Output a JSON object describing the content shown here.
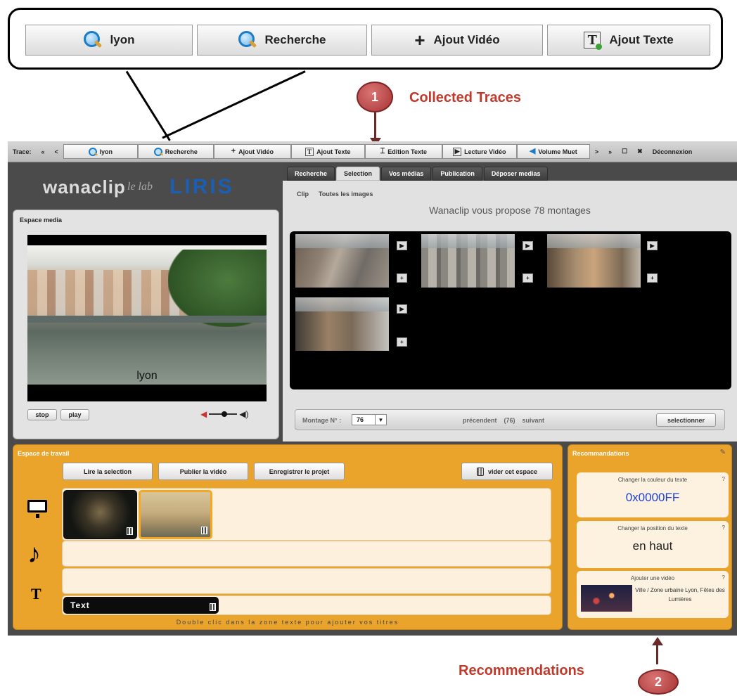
{
  "callout": {
    "buttons": [
      {
        "label": "lyon",
        "icon": "search-icon"
      },
      {
        "label": "Recherche",
        "icon": "search-icon"
      },
      {
        "label": "Ajout Vidéo",
        "icon": "plus-icon"
      },
      {
        "label": "Ajout Texte",
        "icon": "text-icon"
      }
    ]
  },
  "annotations": {
    "marker1": "1",
    "label1": "Collected Traces",
    "marker2": "2",
    "label2": "Recommendations"
  },
  "toolbar": {
    "trace_label": "Trace:",
    "first": "«",
    "prev": "<",
    "buttons": [
      "lyon",
      "Recherche",
      "Ajout Vidéo",
      "Ajout Texte",
      "Edition Texte",
      "Lecture Vidéo",
      "Volume Muet"
    ],
    "next": ">",
    "last": "»",
    "close": "✖",
    "logout": "Déconnexion"
  },
  "logo": {
    "wana": "wanaclip",
    "lelab": "le lab",
    "liris": "LIRIS"
  },
  "media": {
    "title": "Espace media",
    "caption": "lyon",
    "stop": "stop",
    "play": "play"
  },
  "tabs": [
    "Recherche",
    "Selection",
    "Vos médias",
    "Publication",
    "Déposer medias"
  ],
  "selection": {
    "links": [
      "Clip",
      "Toutes les images"
    ],
    "propose": "Wanaclip vous propose 78 montages",
    "play_glyph": "▶",
    "add_glyph": "+",
    "montage_label": "Montage N° :",
    "montage_value": "76",
    "dropdown_glyph": "▼",
    "prev": "précendent",
    "count": "(76)",
    "next": "suivant",
    "select_button": "selectionner"
  },
  "workspace": {
    "title": "Espace de travail",
    "buttons": [
      "Lire la selection",
      "Publier la vidéo",
      "Enregistrer le projet"
    ],
    "clear": "vider cet espace",
    "text_clip": "Text",
    "hint": "Double clic dans la zone texte pour ajouter vos titres",
    "music_glyph": "♪",
    "text_glyph": "T"
  },
  "recommendations": {
    "title": "Recommandations",
    "cards": [
      {
        "label": "Changer la couleur du texte",
        "value": "0x0000FF",
        "help": "?"
      },
      {
        "label": "Changer la position du texte",
        "value": "en haut",
        "help": "?"
      },
      {
        "label": "Ajouter une vidéo",
        "desc": "Ville / Zone urbaine Lyon, Fêtes des Lumières",
        "help": "?"
      }
    ]
  },
  "colors": {
    "workspace": "#eaa42b",
    "accent_red": "#c0392b",
    "value_blue": "#1a3fd6"
  }
}
